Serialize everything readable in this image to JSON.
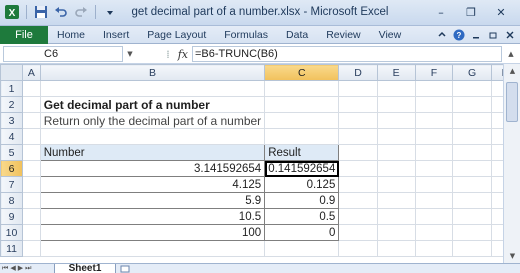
{
  "window": {
    "title": "get decimal part of a number.xlsx - Microsoft Excel",
    "controls": {
      "minimize": "–",
      "restore": "❐",
      "close": "✕"
    }
  },
  "ribbon": {
    "file_label": "File",
    "tabs": [
      "Home",
      "Insert",
      "Page Layout",
      "Formulas",
      "Data",
      "Review",
      "View"
    ]
  },
  "formula_bar": {
    "name_box": "C6",
    "fx": "fx",
    "formula": "=B6-TRUNC(B6)"
  },
  "grid": {
    "columns": [
      "A",
      "B",
      "C",
      "D",
      "E",
      "F",
      "G",
      "H"
    ],
    "rows": [
      "1",
      "2",
      "3",
      "4",
      "5",
      "6",
      "7",
      "8",
      "9",
      "10",
      "11"
    ],
    "title": "Get decimal part of a number",
    "subtitle": "Return only the decimal part of a number",
    "table_headers": {
      "number": "Number",
      "result": "Result"
    },
    "table_rows": [
      {
        "number": "3.141592654",
        "result": "0.141592654"
      },
      {
        "number": "4.125",
        "result": "0.125"
      },
      {
        "number": "5.9",
        "result": "0.9"
      },
      {
        "number": "10.5",
        "result": "0.5"
      },
      {
        "number": "100",
        "result": "0"
      }
    ]
  },
  "sheets": {
    "active": "Sheet1"
  },
  "colors": {
    "file_tab": "#1e7a3c",
    "selected_header": "#f1c15c",
    "table_header": "#deeaf6"
  }
}
